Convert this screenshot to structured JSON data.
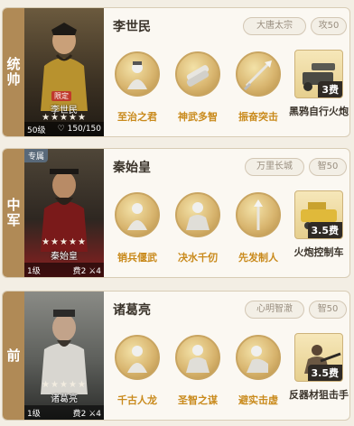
{
  "cards": [
    {
      "side_label": "统帅",
      "portrait": {
        "badge": "",
        "limited": "限定",
        "name": "李世民",
        "stars": "★★★★★",
        "level": "50级",
        "troops": "150/150",
        "extra": ""
      },
      "hero_name": "李世民",
      "tags": [
        "大唐太宗",
        "攻50"
      ],
      "skills": [
        {
          "name": "至治之君",
          "icon": "sage-icon"
        },
        {
          "name": "神武多智",
          "icon": "scroll-icon"
        },
        {
          "name": "振奋突击",
          "icon": "spear-icon"
        }
      ],
      "item": {
        "name": "黑鸦自行火炮",
        "cost": "3费",
        "icon": "cannon-icon"
      }
    },
    {
      "side_label": "中军",
      "portrait": {
        "badge": "专属",
        "limited": "",
        "name": "秦始皇",
        "stars": "★★★★★",
        "level": "1级",
        "troops": "",
        "extra": "费2 ⚔4"
      },
      "hero_name": "秦始皇",
      "tags": [
        "万里长城",
        "智50"
      ],
      "skills": [
        {
          "name": "销兵偃武",
          "icon": "sage-icon"
        },
        {
          "name": "决水千仞",
          "icon": "warrior-icon"
        },
        {
          "name": "先发制人",
          "icon": "spear-icon"
        }
      ],
      "item": {
        "name": "火炮控制车",
        "cost": "3.5费",
        "icon": "vehicle-icon"
      }
    },
    {
      "side_label": "前",
      "portrait": {
        "badge": "",
        "limited": "",
        "name": "诸葛亮",
        "stars": "★★★★★",
        "level": "1级",
        "troops": "",
        "extra": "费2 ⚔4"
      },
      "hero_name": "诸葛亮",
      "tags": [
        "心明智澈",
        "智50"
      ],
      "skills": [
        {
          "name": "千古人龙",
          "icon": "sage-icon"
        },
        {
          "name": "圣智之谋",
          "icon": "warrior-icon"
        },
        {
          "name": "避实击虚",
          "icon": "warrior-icon"
        }
      ],
      "item": {
        "name": "反器材狙击手",
        "cost": "3.5费",
        "icon": "sniper-icon"
      }
    }
  ]
}
